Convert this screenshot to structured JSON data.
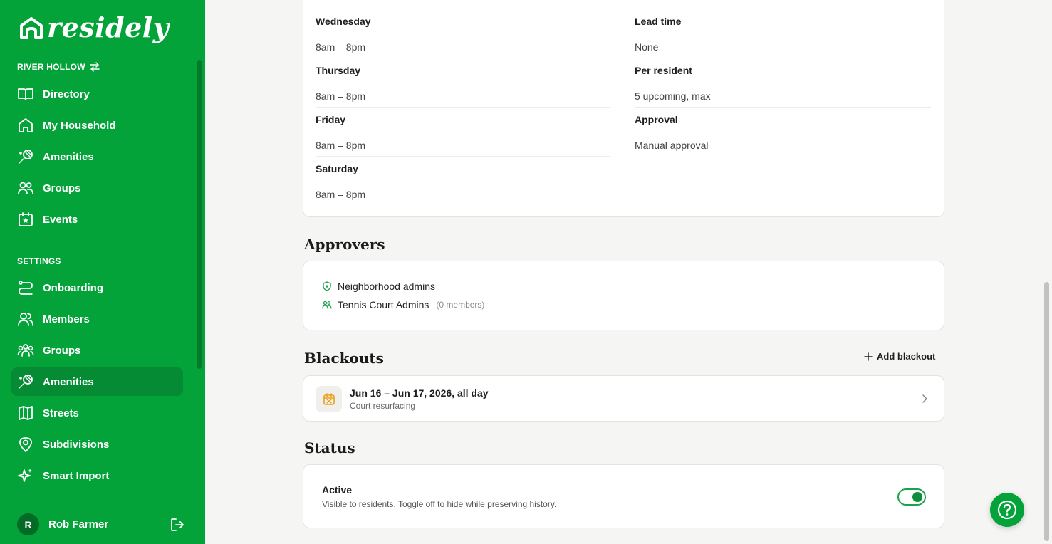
{
  "brand": {
    "name": "residely"
  },
  "sidebar": {
    "community": "RIVER HOLLOW",
    "main_items": [
      {
        "label": "Directory",
        "icon": "book-open-icon"
      },
      {
        "label": "My Household",
        "icon": "home-icon"
      },
      {
        "label": "Amenities",
        "icon": "tennis-racket-icon"
      },
      {
        "label": "Groups",
        "icon": "users-icon"
      },
      {
        "label": "Events",
        "icon": "calendar-star-icon"
      }
    ],
    "settings_label": "SETTINGS",
    "settings_items": [
      {
        "label": "Onboarding",
        "icon": "route-icon"
      },
      {
        "label": "Members",
        "icon": "members-icon"
      },
      {
        "label": "Groups",
        "icon": "users-icon"
      },
      {
        "label": "Amenities",
        "icon": "tennis-racket-icon",
        "active": true
      },
      {
        "label": "Streets",
        "icon": "map-icon"
      },
      {
        "label": "Subdivisions",
        "icon": "map-pin-icon"
      },
      {
        "label": "Smart Import",
        "icon": "sparkles-icon"
      }
    ],
    "user": {
      "initial": "R",
      "name": "Rob Farmer"
    }
  },
  "hours": {
    "rows": [
      {
        "day": "Wednesday",
        "time": "8am – 8pm"
      },
      {
        "day": "Thursday",
        "time": "8am – 8pm"
      },
      {
        "day": "Friday",
        "time": "8am – 8pm"
      },
      {
        "day": "Saturday",
        "time": "8am – 8pm"
      }
    ]
  },
  "rules": {
    "rows": [
      {
        "label": "Lead time",
        "value": "None"
      },
      {
        "label": "Per resident",
        "value": "5 upcoming, max"
      },
      {
        "label": "Approval",
        "value": "Manual approval"
      }
    ]
  },
  "approvers": {
    "title": "Approvers",
    "items": [
      {
        "name": "Neighborhood admins",
        "icon": "shield-star-icon",
        "note": ""
      },
      {
        "name": "Tennis Court Admins",
        "icon": "users-icon",
        "note": "(0 members)"
      }
    ]
  },
  "blackouts": {
    "title": "Blackouts",
    "add_label": "Add blackout",
    "items": [
      {
        "title": "Jun 16 – Jun 17, 2026, all day",
        "subtitle": "Court resurfacing",
        "icon": "calendar-off-icon"
      }
    ]
  },
  "status": {
    "title": "Status",
    "label": "Active",
    "description": "Visible to residents. Toggle off to hide while preserving history.",
    "active": true
  },
  "colors": {
    "brand": "#03a33a",
    "brand_dark": "#048b33",
    "warning": "#e8a21a"
  }
}
